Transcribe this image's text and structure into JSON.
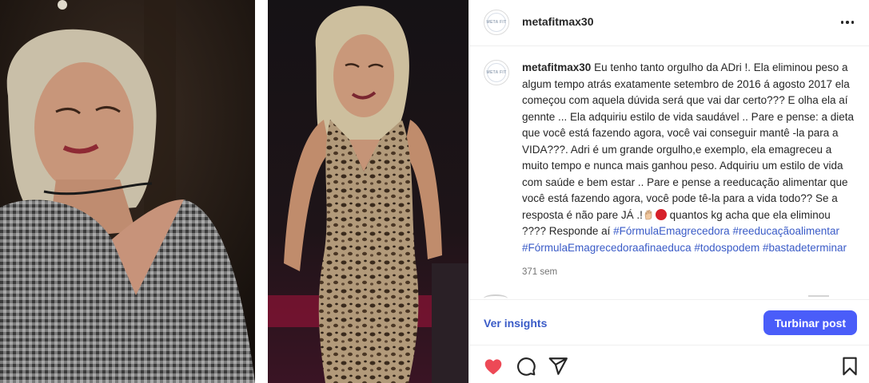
{
  "post": {
    "username": "metafitmax30",
    "avatar_text": "META FIT",
    "caption": {
      "username": "metafitmax30",
      "text_main": "Eu tenho tanto orgulho da ADri !. Ela eliminou peso a algum tempo atrás exatamente setembro de 2016 á agosto 2017 ela começou com aquela dúvida será que vai dar certo??? E olha ela aí gennte ... Ela adquiriu estilo de vida saudável .. Pare e pense: a dieta que você está fazendo agora, você vai conseguir mantê -la para a VIDA???. Adri é um grande orgulho,e exemplo, ela emagreceu a muito tempo e nunca mais ganhou peso. Adquiriu um estilo de vida com saúde e bem estar .. Pare e pense a reeducação alimentar que você está fazendo agora, você pode tê-la para a vida todo?? Se a resposta é não pare JÁ .!",
      "text_after_emoji": "quantos kg acha que ela eliminou ???? Responde aí",
      "hashtags": [
        "#FórmulaEmagrecedora",
        "#reeducaçãoalimentar",
        "#FórmulaEmagrecedoraafinaeduca",
        "#todospodem",
        "#bastadeterminar"
      ]
    },
    "time_ago": "371 sem"
  },
  "actions": {
    "insights_label": "Ver insights",
    "boost_label": "Turbinar post",
    "icons": [
      "heart-icon",
      "comment-icon",
      "share-icon",
      "bookmark-icon"
    ]
  },
  "colors": {
    "accent": "#4a5df9",
    "link": "#3a5bc7",
    "heart": "#ed4956",
    "text": "#262626",
    "muted": "#737373"
  }
}
